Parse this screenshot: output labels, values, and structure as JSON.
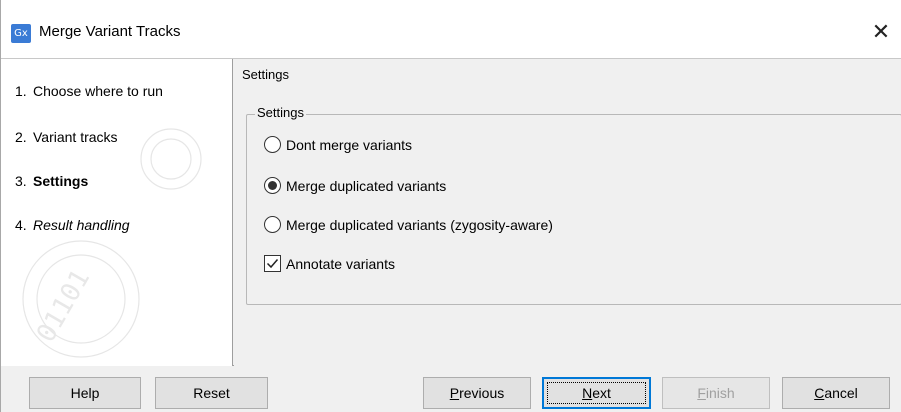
{
  "window": {
    "icon_text": "Gx",
    "title": "Merge Variant Tracks",
    "close_glyph": "✕"
  },
  "sidebar": {
    "steps": [
      {
        "num": "1.",
        "label": "Choose where to run",
        "state": "done"
      },
      {
        "num": "2.",
        "label": "Variant tracks",
        "state": "done"
      },
      {
        "num": "3.",
        "label": "Settings",
        "state": "current"
      },
      {
        "num": "4.",
        "label": "Result handling",
        "state": "future"
      }
    ]
  },
  "panel": {
    "title": "Settings",
    "group_legend": "Settings",
    "options": [
      {
        "type": "radio",
        "label": "Dont merge variants",
        "checked": false
      },
      {
        "type": "radio",
        "label": "Merge duplicated variants",
        "checked": true
      },
      {
        "type": "radio",
        "label": "Merge duplicated variants (zygosity-aware)",
        "checked": false
      },
      {
        "type": "checkbox",
        "label": "Annotate variants",
        "checked": true
      }
    ]
  },
  "buttons": {
    "help": "Help",
    "reset": "Reset",
    "previous_u": "P",
    "previous_rest": "revious",
    "next_u": "N",
    "next_rest": "ext",
    "finish_u": "F",
    "finish_rest": "inish",
    "cancel_u": "C",
    "cancel_rest": "ancel"
  },
  "colors": {
    "accent": "#0078d7",
    "icon_bg": "#3a7bd5",
    "dialog_bg": "#f0f0f0"
  }
}
